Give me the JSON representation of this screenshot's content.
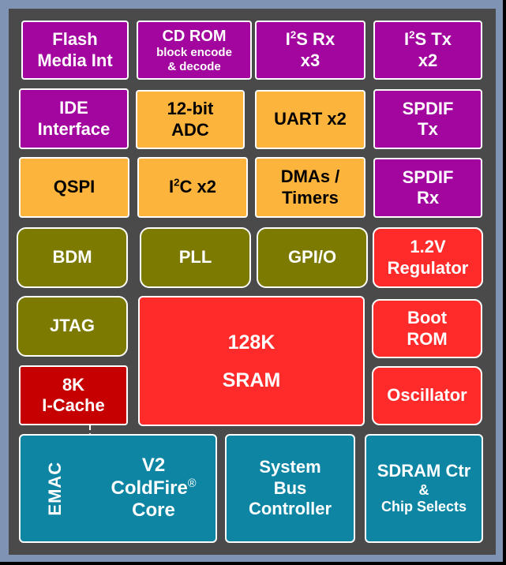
{
  "diagram": {
    "title": "",
    "colors": {
      "frame": "#7f94b5",
      "background": "#4a4a4a",
      "audio_storage": "#a2069e",
      "peripherals": "#fdb43c",
      "debug_clock_io": "#7c7a00",
      "memory_power": "#ff2a2a",
      "cache": "#c60000",
      "core_bus": "#0e86a3"
    },
    "blocks": {
      "flash_media": {
        "line1": "Flash",
        "line2": "Media Int"
      },
      "cd_rom": {
        "line1": "CD ROM",
        "line2": "block encode",
        "line3": "& decode"
      },
      "i2s_rx": {
        "prefix": "I",
        "sup": "2",
        "suffix": "S Rx",
        "line2": "x3"
      },
      "i2s_tx": {
        "prefix": "I",
        "sup": "2",
        "suffix": "S Tx",
        "line2": "x2"
      },
      "ide": {
        "line1": "IDE",
        "line2": "Interface"
      },
      "adc": {
        "line1": "12-bit",
        "line2": "ADC"
      },
      "uart": {
        "line1": "UART x2"
      },
      "spdif_tx": {
        "line1": "SPDIF",
        "line2": "Tx"
      },
      "qspi": {
        "line1": "QSPI"
      },
      "i2c": {
        "prefix": "I",
        "sup": "2",
        "suffix": "C x2"
      },
      "dma": {
        "line1": "DMAs /",
        "line2": "Timers"
      },
      "spdif_rx": {
        "line1": "SPDIF",
        "line2": "Rx"
      },
      "bdm": {
        "line1": "BDM"
      },
      "pll": {
        "line1": "PLL"
      },
      "gpio": {
        "line1": "GPI/O"
      },
      "regulator": {
        "line1": "1.2V",
        "line2": "Regulator"
      },
      "jtag": {
        "line1": "JTAG"
      },
      "sram": {
        "line1": "128K",
        "line2": "SRAM"
      },
      "boot_rom": {
        "line1": "Boot",
        "line2": "ROM"
      },
      "icache": {
        "line1": "8K",
        "line2": "I-Cache"
      },
      "oscillator": {
        "line1": "Oscillator"
      },
      "core": {
        "emac": "EMAC",
        "line1": "V2",
        "line2": "ColdFire",
        "reg": "®",
        "line3": "Core"
      },
      "bus_ctrl": {
        "line1": "System",
        "line2": "Bus",
        "line3": "Controller"
      },
      "sdram": {
        "line1": "SDRAM Ctr",
        "line2": "&",
        "line3": "Chip Selects"
      }
    }
  }
}
